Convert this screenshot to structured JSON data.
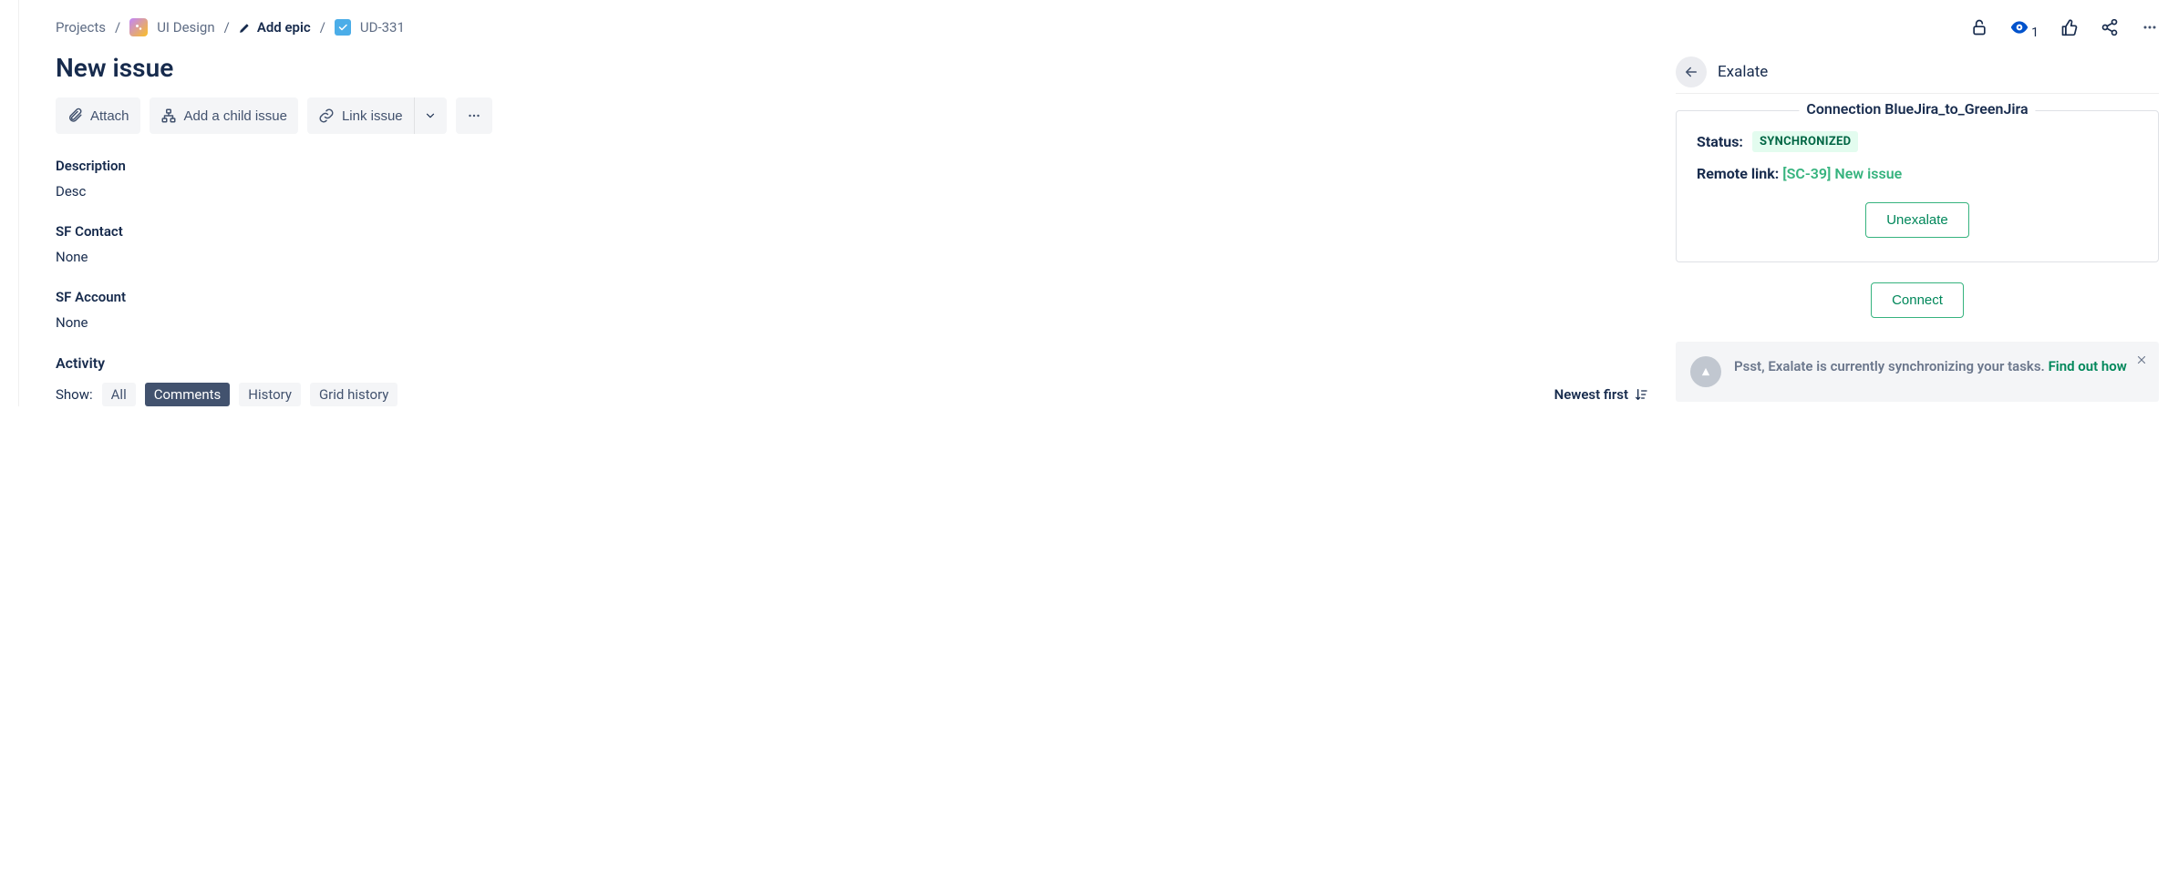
{
  "breadcrumb": {
    "projects": "Projects",
    "project_name": "UI Design",
    "add_epic": "Add epic",
    "issue_key": "UD-331"
  },
  "header_actions": {
    "watch_count": "1"
  },
  "issue": {
    "title": "New issue"
  },
  "toolbar": {
    "attach": "Attach",
    "add_child": "Add a child issue",
    "link_issue": "Link issue"
  },
  "fields": {
    "description": {
      "label": "Description",
      "value": "Desc"
    },
    "sf_contact": {
      "label": "SF Contact",
      "value": "None"
    },
    "sf_account": {
      "label": "SF Account",
      "value": "None"
    }
  },
  "activity": {
    "title": "Activity",
    "show_label": "Show:",
    "tabs": {
      "all": "All",
      "comments": "Comments",
      "history": "History",
      "grid_history": "Grid history"
    },
    "sort": "Newest first"
  },
  "panel": {
    "title": "Exalate",
    "connection": {
      "legend": "Connection BlueJira_to_GreenJira",
      "status_label": "Status:",
      "status_value": "SYNCHRONIZED",
      "remote_label": "Remote link:",
      "remote_link": "[SC-39] New issue",
      "unexalate": "Unexalate"
    },
    "connect": "Connect",
    "hint": {
      "text": "Psst, Exalate is currently synchronizing your tasks.",
      "link": "Find out how"
    }
  }
}
